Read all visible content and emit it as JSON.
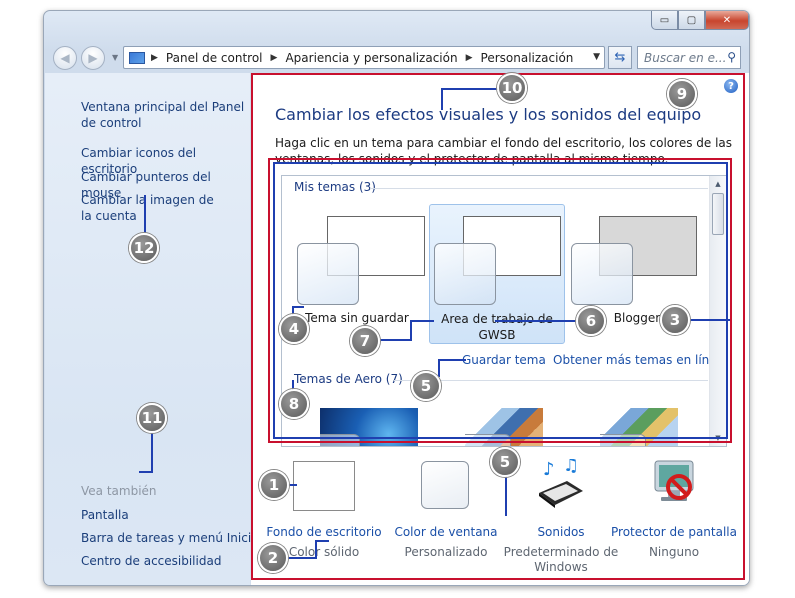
{
  "window": {
    "buttons": {
      "minimize": "▭",
      "maximize": "▢",
      "close": "✕"
    }
  },
  "nav": {
    "back": "◀",
    "forward": "▶",
    "breadcrumb": [
      "Panel de control",
      "Apariencia y personalización",
      "Personalización"
    ],
    "search_placeholder": "Buscar en e..."
  },
  "sidebar": {
    "links": [
      "Ventana principal del Panel de control",
      "Cambiar iconos del escritorio",
      "Cambiar punteros del mouse",
      "Cambiar la imagen de la cuenta"
    ],
    "see_also_heading": "Vea también",
    "see_also": [
      "Pantalla",
      "Barra de tareas y menú Inicio",
      "Centro de accesibilidad"
    ]
  },
  "main": {
    "help": "?",
    "title": "Cambiar los efectos visuales y los sonidos del equipo",
    "description": "Haga clic en un tema para cambiar el fondo del escritorio, los colores de las ventanas, los sonidos y el protector de pantalla al mismo tiempo.",
    "my_themes_heading": "Mis temas (3)",
    "themes": [
      {
        "label": "Tema sin guardar"
      },
      {
        "label": "Area de trabajo de GWSB"
      },
      {
        "label": "Blogger"
      }
    ],
    "save_theme": "Guardar tema",
    "more_themes": "Obtener más temas en línea",
    "aero_heading": "Temas de Aero (7)"
  },
  "bottom": [
    {
      "label": "Fondo de escritorio",
      "sub": "Color sólido",
      "icon": "desktop-background-icon"
    },
    {
      "label": "Color de ventana",
      "sub": "Personalizado",
      "icon": "window-color-icon"
    },
    {
      "label": "Sonidos",
      "sub": "Predeterminado de Windows",
      "icon": "sounds-icon"
    },
    {
      "label": "Protector de pantalla",
      "sub": "Ninguno",
      "icon": "screensaver-icon"
    }
  ],
  "callouts": [
    "1",
    "2",
    "3",
    "4",
    "5",
    "5",
    "6",
    "7",
    "8",
    "9",
    "10",
    "11",
    "12"
  ],
  "colors": {
    "annotation_red": "#c8102e",
    "annotation_blue": "#1f3fb0",
    "link": "#1b50a8",
    "title": "#1c3b82"
  }
}
